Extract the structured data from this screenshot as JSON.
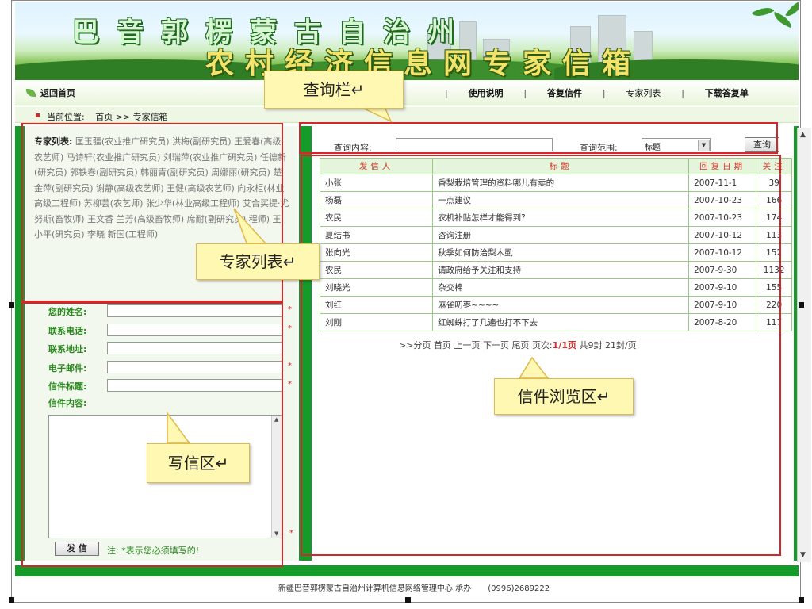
{
  "banner": {
    "title_line1": "巴音郭楞蒙古自治州",
    "title_line2": "农村经济信息网专家信箱"
  },
  "nav": {
    "home": "返回首页",
    "items": [
      "使用说明",
      "答复信件",
      "专家列表",
      "下载答复单"
    ],
    "separator": "|"
  },
  "breadcrumb": {
    "label": "当前位置:",
    "path": "首页 >> 专家信箱"
  },
  "experts": {
    "label": "专家列表:",
    "text": "匡玉疆(农业推广研究员) 洪梅(副研究员) 王爱春(高级农艺师) 马诗轩(农业推广研究员) 刘瑞萍(农业推广研究员) 任德新(研究员) 郭铁春(副研究员) 韩丽青(副研究员) 周娜丽(研究员) 楚金萍(副研究员) 谢静(高级农艺师) 王健(高级农艺师) 向永柜(林业高级工程师) 苏柳芸(农艺师) 张少华(林业高级工程师) 艾合买提·尤努斯(畜牧师) 王文香 兰芳(高级畜牧师) 席耐(副研究员) 程师) 王小平(研究员) 李晓 新国(工程师)"
  },
  "form": {
    "name_label": "您的姓名:",
    "phone_label": "联系电话:",
    "address_label": "联系地址:",
    "email_label": "电子邮件:",
    "subject_label": "信件标题:",
    "content_label": "信件内容:",
    "required_mark": "*",
    "send_button": "发 信",
    "note": "注: *表示您必须填写的!"
  },
  "query": {
    "content_label": "查询内容:",
    "content_value": "",
    "range_label": "查询范围:",
    "range_selected": "标题",
    "button": "查询"
  },
  "table": {
    "headers": [
      "发信人",
      "标题",
      "回复日期",
      "关注"
    ],
    "rows": [
      [
        "小张",
        "香梨栽培管理的资料哪儿有卖的",
        "2007-11-1",
        "39"
      ],
      [
        "杨磊",
        "一点建议",
        "2007-10-23",
        "166"
      ],
      [
        "农民",
        "农机补贴怎样才能得到?",
        "2007-10-23",
        "174"
      ],
      [
        "夏结书",
        "咨询注册",
        "2007-10-12",
        "113"
      ],
      [
        "张向光",
        "秋季如何防治梨木虱",
        "2007-10-12",
        "152"
      ],
      [
        "农民",
        "请政府给予关注和支持",
        "2007-9-30",
        "1132"
      ],
      [
        "刘晓光",
        "杂交棉",
        "2007-9-10",
        "155"
      ],
      [
        "刘红",
        "麻雀叨枣~~~~",
        "2007-9-10",
        "220"
      ],
      [
        "刘刚",
        "红蜘蛛打了几遍也打不下去",
        "2007-8-20",
        "117"
      ]
    ]
  },
  "pager": {
    "prefix": ">>分页",
    "first": "首页",
    "prev": "上一页",
    "next": "下一页",
    "last": "尾页",
    "page_label": "页次:",
    "page_value": "1/1页",
    "total": "共9封",
    "per_page": "21封/页"
  },
  "footer": {
    "org": "新疆巴音郭楞蒙古自治州计算机信息网络管理中心 承办",
    "phone": "(0996)2689222"
  },
  "callouts": {
    "query_bar": "查询栏↵",
    "expert_list": "专家列表↵",
    "letter_browse": "信件浏览区↵",
    "write_area": "写信区↵"
  },
  "colors": {
    "frame_green": "#149b2a",
    "header_red": "#d63a2a",
    "highlight_box": "#d6262a",
    "callout_fill": "#fff8b3"
  }
}
